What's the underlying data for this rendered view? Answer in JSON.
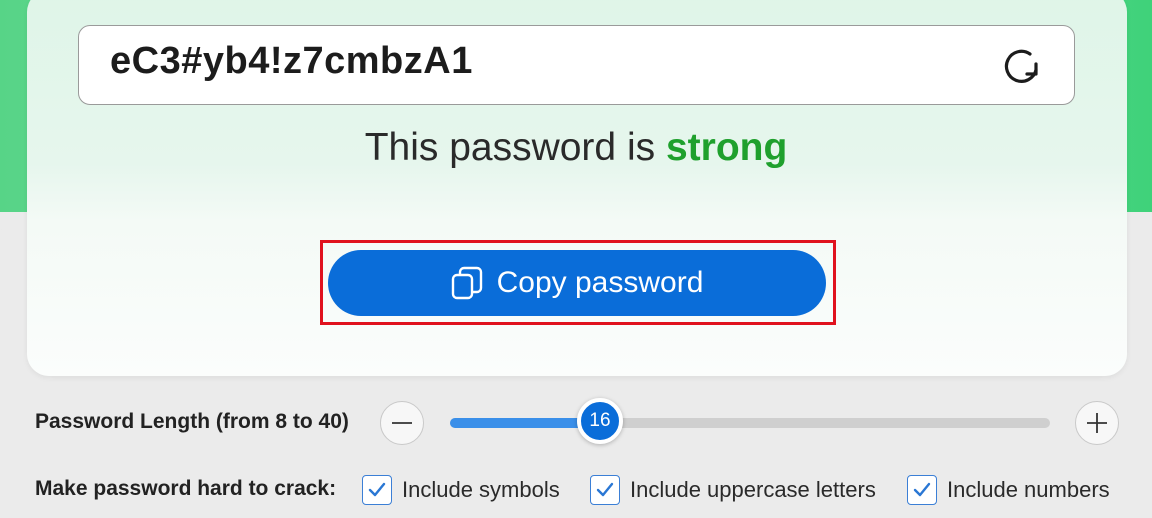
{
  "password": {
    "value": "eC3#yb4!z7cmbzA1"
  },
  "strength": {
    "prefix": "This password is",
    "level": "strong",
    "level_color": "#1fa02d"
  },
  "copy_button": {
    "label": "Copy password",
    "icon": "copy-icon"
  },
  "length": {
    "label": "Password Length (from 8 to 40)",
    "min": 8,
    "max": 40,
    "value": "16"
  },
  "options": {
    "label": "Make password hard to crack:",
    "items": [
      {
        "label": "Include symbols",
        "checked": true
      },
      {
        "label": "Include uppercase letters",
        "checked": true
      },
      {
        "label": "Include numbers",
        "checked": true
      }
    ]
  },
  "colors": {
    "accent": "#0a6dd9",
    "highlight_outline": "#e0121e"
  }
}
